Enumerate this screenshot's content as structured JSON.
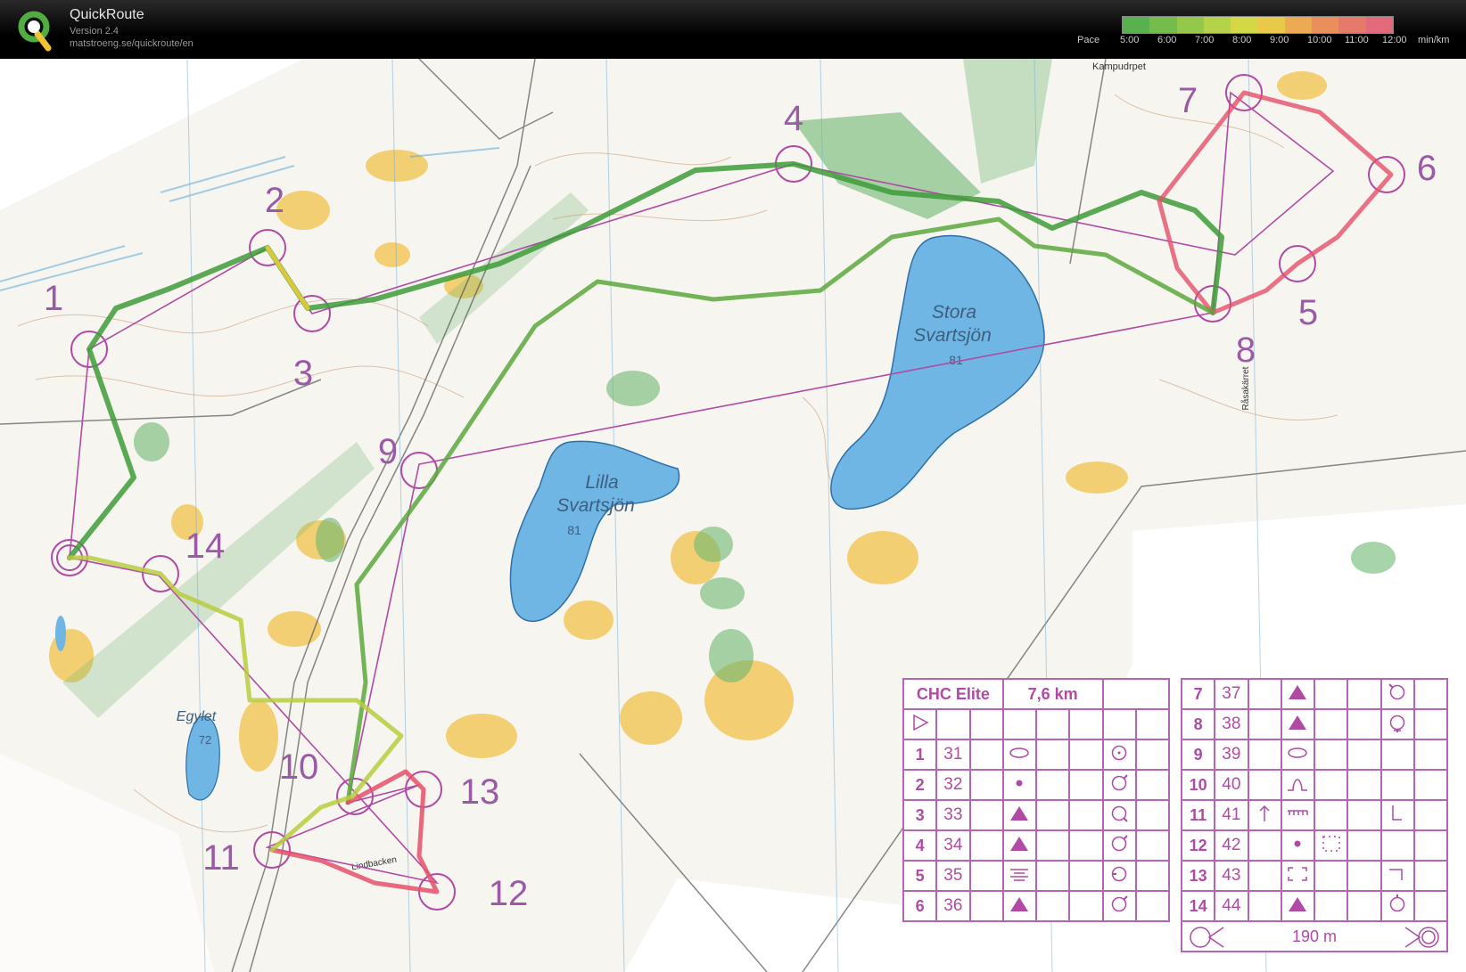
{
  "app": {
    "title": "QuickRoute",
    "version": "Version 2.4",
    "url": "matstroeng.se/quickroute/en"
  },
  "pace_legend": {
    "label": "Pace",
    "ticks": [
      "5:00",
      "6:00",
      "7:00",
      "8:00",
      "9:00",
      "10:00",
      "11:00",
      "12:00"
    ],
    "unit": "min/km",
    "colors": [
      "#58b04f",
      "#74bd4c",
      "#93c84a",
      "#b4d24a",
      "#d2d846",
      "#e9c94a",
      "#ecab52",
      "#ea8f5c",
      "#e67a6a",
      "#e26a7a"
    ]
  },
  "map": {
    "lakes": [
      {
        "name": "Stora Svartsjön",
        "line1": "Stora",
        "line2": "Svartsjön",
        "height": "81"
      },
      {
        "name": "Lilla Svartsjön",
        "line1": "Lilla",
        "line2": "Svartsjön",
        "height": "81"
      },
      {
        "name": "Egylet",
        "line1": "Egylet",
        "height": "72"
      }
    ],
    "place_labels": [
      "Kampudrpet",
      "Råsakärret",
      "Lindbacken"
    ],
    "control_numbers": [
      "1",
      "2",
      "3",
      "4",
      "5",
      "6",
      "7",
      "8",
      "9",
      "10",
      "11",
      "12",
      "13",
      "14"
    ],
    "colors": {
      "course": "#b04aa5",
      "water": "#6fb6e4",
      "open_land": "#f2c24a",
      "green": "#6db870",
      "route_fast": "#3e9b3a",
      "route_slow": "#e5506a"
    }
  },
  "control_description": {
    "event": "CHC Elite",
    "length": "7,6 km",
    "finish_distance": "190 m",
    "controls": [
      {
        "n": "1",
        "code": "31",
        "feature": "ellipse",
        "detail": "circle-dot"
      },
      {
        "n": "2",
        "code": "32",
        "feature": "dot",
        "detail": "circle-ne"
      },
      {
        "n": "3",
        "code": "33",
        "feature": "triangle",
        "detail": "circle-se"
      },
      {
        "n": "4",
        "code": "34",
        "feature": "triangle",
        "detail": "circle-ne"
      },
      {
        "n": "5",
        "code": "35",
        "feature": "marsh",
        "detail": "circle-w"
      },
      {
        "n": "6",
        "code": "36",
        "feature": "triangle",
        "detail": "circle-ne"
      },
      {
        "n": "7",
        "code": "37",
        "feature": "triangle",
        "detail": "circle-nw"
      },
      {
        "n": "8",
        "code": "38",
        "feature": "triangle",
        "detail": "circle-s"
      },
      {
        "n": "9",
        "code": "39",
        "feature": "ellipse",
        "detail": ""
      },
      {
        "n": "10",
        "code": "40",
        "feature": "knoll",
        "detail": ""
      },
      {
        "n": "11",
        "code": "41",
        "feature": "cliff",
        "detail": "foot"
      },
      {
        "n": "12",
        "code": "42",
        "feature": "dot",
        "detail": "",
        "extra": "dotted-square"
      },
      {
        "n": "13",
        "code": "43",
        "feature": "bracket-square",
        "detail": "corner"
      },
      {
        "n": "14",
        "code": "44",
        "feature": "triangle",
        "detail": "circle-n"
      }
    ]
  }
}
